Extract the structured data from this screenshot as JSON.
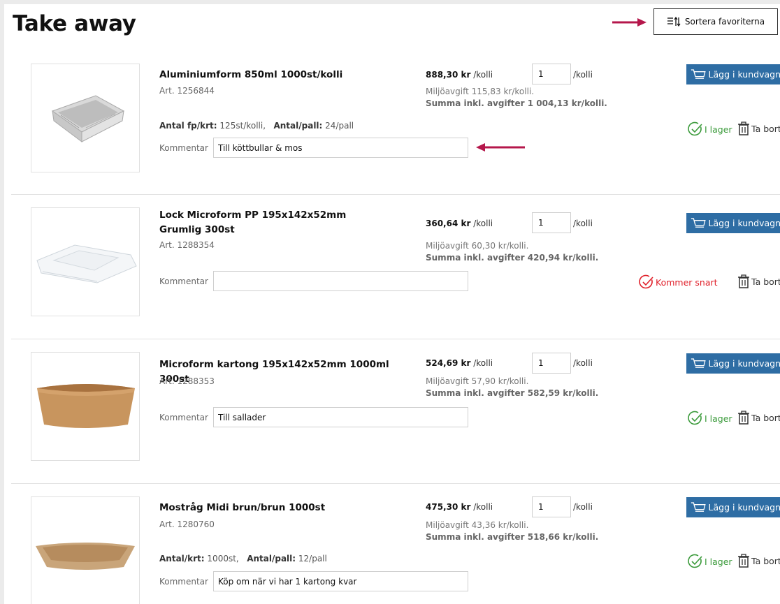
{
  "page": {
    "title": "Take away",
    "sort_button_label": "Sortera favoriterna"
  },
  "colors": {
    "cart_button": "#2e6da4",
    "in_stock": "#3a9a3a",
    "coming_soon": "#e0202a",
    "annotation_arrow": "#b5174b"
  },
  "products": [
    {
      "name": "Aluminiumform 850ml 1000st/kolli",
      "art": "Art. 1256844",
      "price_value": "888,30 kr",
      "price_unit": "/kolli",
      "qty": "1",
      "per_label": "/kolli",
      "fee": "Miljöavgift 115,83 kr/kolli.",
      "total": "Summa inkl. avgifter 1 004,13 kr/kolli.",
      "antal_a_label": "Antal fp/krt:",
      "antal_a_value": "125st/kolli,",
      "antal_b_label": "Antal/pall:",
      "antal_b_value": "24/pall",
      "comment_label": "Kommentar",
      "comment": "Till köttbullar & mos",
      "cart_label": "Lägg i kundvagn",
      "status": "I lager",
      "remove_label": "Ta bort"
    },
    {
      "name": "Lock Microform PP 195x142x52mm Grumlig 300st",
      "art": "Art. 1288354",
      "price_value": "360,64 kr",
      "price_unit": "/kolli",
      "qty": "1",
      "per_label": "/kolli",
      "fee": "Miljöavgift 60,30 kr/kolli.",
      "total": "Summa inkl. avgifter 420,94 kr/kolli.",
      "comment_label": "Kommentar",
      "comment": "",
      "cart_label": "Lägg i kundvagn",
      "status": "Kommer snart",
      "remove_label": "Ta bort"
    },
    {
      "name": "Microform kartong 195x142x52mm 1000ml 300st",
      "art": "Art. 1288353",
      "price_value": "524,69 kr",
      "price_unit": "/kolli",
      "qty": "1",
      "per_label": "/kolli",
      "fee": "Miljöavgift 57,90 kr/kolli.",
      "total": "Summa inkl. avgifter 582,59 kr/kolli.",
      "comment_label": "Kommentar",
      "comment": "Till sallader",
      "cart_label": "Lägg i kundvagn",
      "status": "I lager",
      "remove_label": "Ta bort"
    },
    {
      "name": "Mostråg Midi brun/brun 1000st",
      "art": "Art. 1280760",
      "price_value": "475,30 kr",
      "price_unit": "/kolli",
      "qty": "1",
      "per_label": "/kolli",
      "fee": "Miljöavgift 43,36 kr/kolli.",
      "total": "Summa inkl. avgifter 518,66 kr/kolli.",
      "antal_a_label": "Antal/krt:",
      "antal_a_value": "1000st,",
      "antal_b_label": "Antal/pall:",
      "antal_b_value": "12/pall",
      "comment_label": "Kommentar",
      "comment": "Köp om när vi har 1 kartong kvar",
      "cart_label": "Lägg i kundvagn",
      "status": "I lager",
      "remove_label": "Ta bort"
    }
  ]
}
